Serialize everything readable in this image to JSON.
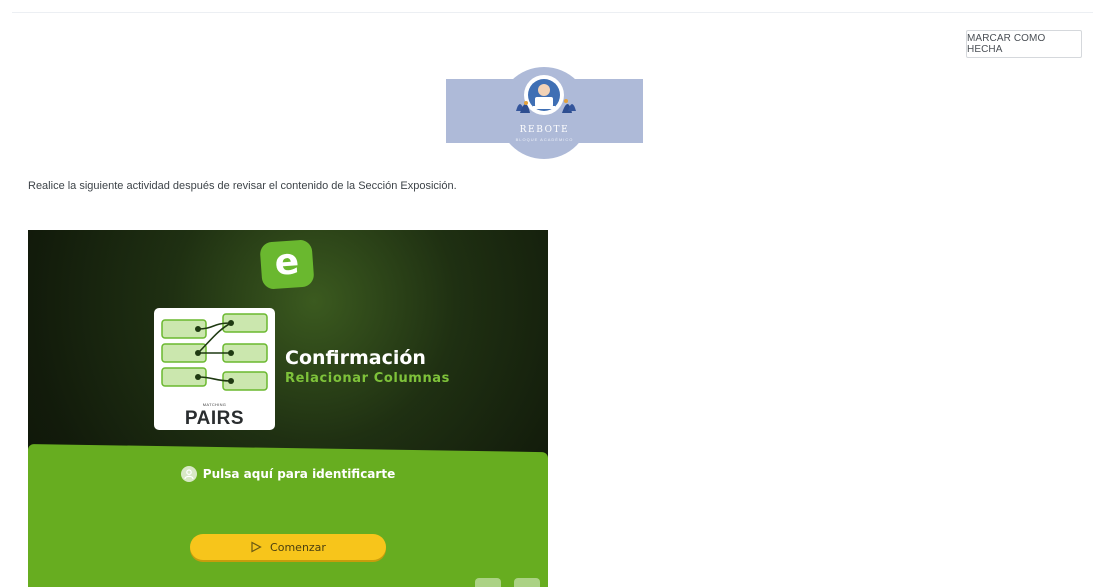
{
  "header": {
    "mark_done_label": "MARCAR COMO HECHA"
  },
  "banner": {
    "title": "REBOTE",
    "subtitle": "BLOQUE ACADÉMICO",
    "color": "#aebad8"
  },
  "instruction": "Realice la siguiente actividad después de revisar el contenido de la Sección Exposición.",
  "activity": {
    "logo_letter": "e",
    "card_label_small": "MATCHING",
    "card_label_big": "PAIRS",
    "title": "Confirmación",
    "subtitle": "Relacionar Columnas",
    "login_text": "Pulsa aquí para identificarte",
    "start_label": "Comenzar",
    "icons": {
      "login": "user-icon",
      "start": "play-icon",
      "controls": [
        "info-icon",
        "fullscreen-icon"
      ]
    },
    "colors": {
      "accent_green": "#6ab82f",
      "panel_green": "#67ad20",
      "button_yellow": "#f7c51b"
    }
  }
}
